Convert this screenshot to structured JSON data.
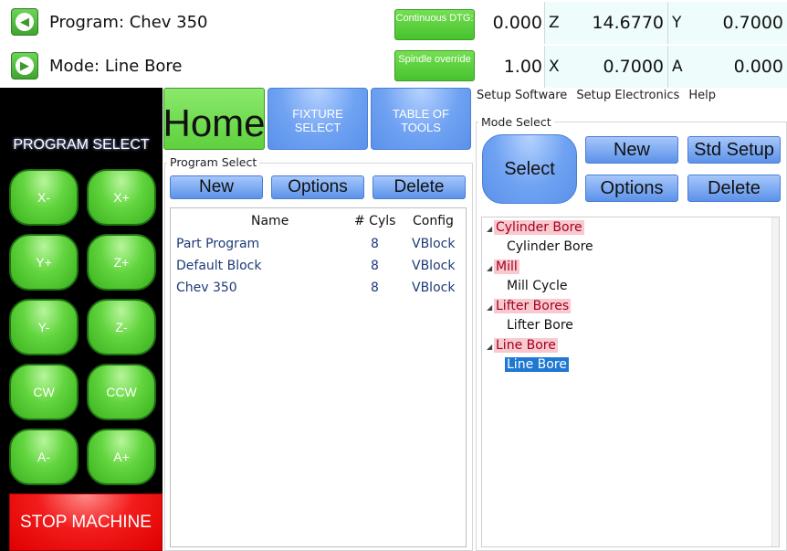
{
  "top": {
    "program_label": "Program: Chev 350",
    "mode_label": "Mode: Line Bore",
    "continuous_btn": "Continuous DTG:",
    "spindle_btn": "Spindle override",
    "row1_value": "0.000",
    "row2_value": "1.00",
    "z_axis": "Z",
    "z_value": "14.6770",
    "y_axis": "Y",
    "y_value": "0.7000",
    "x_axis": "X",
    "x_value": "0.7000",
    "a_axis": "A",
    "a_value": "0.000"
  },
  "left": {
    "program_select": "PROGRAM SELECT",
    "jog": [
      "X-",
      "X+",
      "Y+",
      "Z+",
      "Y-",
      "Z-",
      "CW",
      "CCW",
      "A-",
      "A+"
    ],
    "stop": "STOP MACHINE"
  },
  "center": {
    "home": "Home",
    "fixture": "FIXTURE SELECT",
    "tools": "TABLE OF TOOLS",
    "group_label": "Program Select",
    "new_btn": "New",
    "options_btn": "Options",
    "delete_btn": "Delete",
    "columns": [
      "Name",
      "# Cyls",
      "Config"
    ],
    "rows": [
      {
        "name": "Part Program",
        "cyls": "8",
        "config": "VBlock"
      },
      {
        "name": "Default Block",
        "cyls": "8",
        "config": "VBlock"
      },
      {
        "name": "Chev 350",
        "cyls": "8",
        "config": "VBlock"
      }
    ]
  },
  "right": {
    "menu": [
      "Setup Software",
      "Setup Electronics",
      "Help"
    ],
    "group_label": "Mode Select",
    "select_btn": "Select",
    "new_btn": "New",
    "std_setup_btn": "Std Setup",
    "options_btn": "Options",
    "delete_btn": "Delete",
    "tree": [
      {
        "parent": "Cylinder Bore",
        "child": "Cylinder Bore"
      },
      {
        "parent": "Mill",
        "child": "Mill Cycle"
      },
      {
        "parent": "Lifter Bores",
        "child": "Lifter Bore"
      },
      {
        "parent": "Line Bore",
        "child": "Line Bore"
      }
    ]
  },
  "colors": {
    "green_button": "#5ed03d",
    "blue_button": "#6fa2f2",
    "stop_red": "#e00000",
    "tree_highlight": "#f8c9cf",
    "selection_blue": "#1f78d1"
  }
}
